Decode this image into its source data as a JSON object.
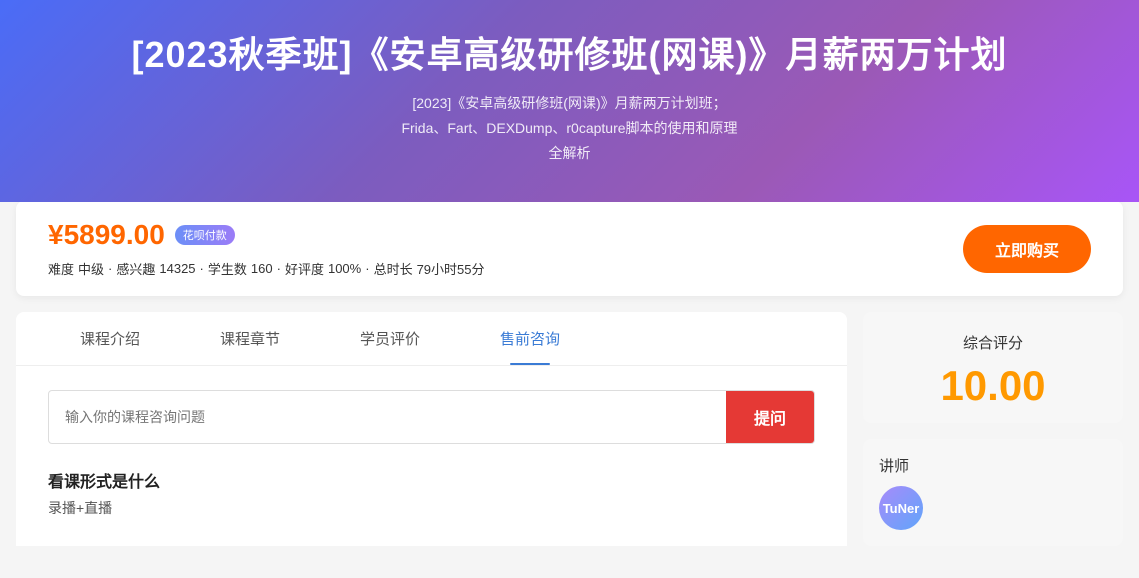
{
  "hero": {
    "title": "[2023秋季班]《安卓高级研修班(网课)》月薪两万计划",
    "subtitle_line1": "[2023]《安卓高级研修班(网课)》月薪两万计划班；",
    "subtitle_line2": "Frida、Fart、DEXDump、r0capture脚本的使用和原理",
    "subtitle_line3": "全解析"
  },
  "price_section": {
    "price": "¥5899.00",
    "badge": "花呗付款",
    "difficulty_label": "难度",
    "difficulty_value": "中级",
    "interest_label": "感兴趣",
    "interest_value": "14325",
    "students_label": "学生数",
    "students_value": "160",
    "rating_label": "好评度",
    "rating_value": "100%",
    "duration_label": "总时长",
    "duration_value": "79小时55分",
    "buy_button": "立即购买"
  },
  "tabs": [
    {
      "id": "intro",
      "label": "课程介绍",
      "active": false
    },
    {
      "id": "chapters",
      "label": "课程章节",
      "active": false
    },
    {
      "id": "reviews",
      "label": "学员评价",
      "active": false
    },
    {
      "id": "consult",
      "label": "售前咨询",
      "active": true
    }
  ],
  "consult": {
    "input_placeholder": "输入你的课程咨询问题",
    "submit_button": "提问",
    "question_title": "看课形式是什么",
    "question_answer": "录播+直播"
  },
  "sidebar": {
    "score_label": "综合评分",
    "score_value": "10.00",
    "instructor_label": "讲师",
    "instructor_avatar_text": "TuNer"
  }
}
